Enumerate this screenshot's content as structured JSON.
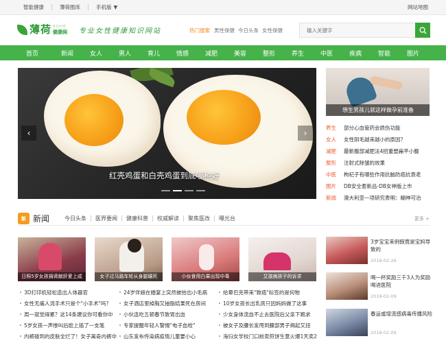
{
  "topbar": {
    "links": [
      "智能健康",
      "薄荷图库",
      "手机版"
    ],
    "right": "网站地图"
  },
  "header": {
    "logo_cn": "薄荷",
    "logo_en": "BOHE",
    "logo_net": "健康网",
    "slogan": "专业女性健康知识网站",
    "hot_label": "热门搜索",
    "hot_keywords": [
      "男性保健",
      "今日头条",
      "女性保健"
    ],
    "search_placeholder": "输入关键字"
  },
  "nav": [
    "首页",
    "新闻",
    "女人",
    "男人",
    "育儿",
    "情感",
    "减肥",
    "美容",
    "整形",
    "养生",
    "中医",
    "疾病",
    "智能",
    "图片"
  ],
  "slider": {
    "caption": "红壳鸡蛋和白壳鸡蛋到底哪种好",
    "prev": "‹",
    "next": "›",
    "active_index": 1,
    "count": 4
  },
  "side_feature": {
    "caption": "想生男孩儿就这样做孕前准备"
  },
  "side_list": [
    {
      "cat": "养生",
      "title": "部分心血管药会损伤功能"
    },
    {
      "cat": "女人",
      "title": "女性阴毛越来越小的原因？"
    },
    {
      "cat": "减肥",
      "title": "最新腹部减肥法4招重塑扁平小腹"
    },
    {
      "cat": "整形",
      "title": "注射式除皱的效果"
    },
    {
      "cat": "中医",
      "title": "枸杞子有哪些作用抗脑防癌抗衰老"
    },
    {
      "cat": "图片",
      "title": "DB安全套新品-DB女神版上市"
    },
    {
      "cat": "新闻",
      "title": "澳大利亚一项研究表明：糊神可治"
    }
  ],
  "news": {
    "title": "新闻",
    "icon_text": "新",
    "tabs": [
      "今日头条",
      "医界要闻",
      "健康科普",
      "权威解读",
      "聚焦医改",
      "曝光台"
    ],
    "more": "更多 +",
    "thumbs": [
      {
        "caption": "日照5岁女孩捐肾献肝爱上成"
      },
      {
        "caption": "女子过马路车轮从身腿碾死"
      },
      {
        "caption": "小伙食用白果出现中毒"
      },
      {
        "caption": "艾滋病孩子的诉求"
      }
    ],
    "lists": [
      [
        "3D打印机轻松造出人体器官",
        "女性无痛人流手术只是个\"小手术\"吗？",
        "周一就觉得累？这14条建议你可看你中",
        "5岁女孩一声惨叫后脸上插了一支笔",
        "内裤碰到的皮肤全烂了！女子离奇内裤中"
      ],
      [
        "24岁伴娘在婚宴上突然被抬出小毛病",
        "女子酒店里掉胸又抽脂结果死在房间",
        "小伙连吃五顿春节致胃出血",
        "专家提醒年轻人警惕\"电子血栓\"",
        "山东发布传染病疫情儿童要小心"
      ],
      [
        "给晕巴克带来\"致癌\"标签的是何物",
        "10岁女孩长出乳房只因妈妈做了这事",
        "少女身体流血不止去医院后父亲下跪求",
        "被女子及腰长发甩到腰部男子揭起又扭",
        "海归女学校门口前卖煎饼生意火爆1天卖2"
      ]
    ]
  },
  "feed": [
    {
      "title": "3岁宝宝来例假竟是宝妈导致的",
      "date": "2018-02-26"
    },
    {
      "title": "喝一杯奖励三千3人为奖励喝进医院",
      "date": "2018-02-09"
    },
    {
      "title": "春运或增流感病毒传播风险",
      "date": "2018-02-09"
    }
  ],
  "colors": {
    "brand": "#45b24a",
    "accent": "#ef5a2a",
    "hot": "#f08a1a"
  }
}
